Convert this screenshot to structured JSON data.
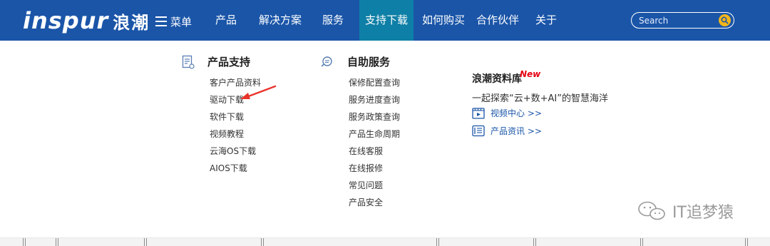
{
  "header": {
    "logo_en": "inspur",
    "logo_cn": "浪潮",
    "menu_label": "菜单",
    "nav": [
      {
        "label": "产品"
      },
      {
        "label": "解决方案"
      },
      {
        "label": "服务"
      },
      {
        "label": "支持下载",
        "active": true
      },
      {
        "label": "如何购买"
      },
      {
        "label": "合作伙伴"
      },
      {
        "label": "关于"
      }
    ],
    "search": {
      "placeholder": "Search"
    }
  },
  "dropdown": {
    "product_support": {
      "title": "产品支持",
      "icon": "document-icon",
      "links": [
        "客户产品资料",
        "驱动下载",
        "软件下载",
        "视频教程",
        "云海OS下载",
        "AIOS下载"
      ]
    },
    "self_service": {
      "title": "自助服务",
      "icon": "magnifier-icon",
      "links": [
        "保修配置查询",
        "服务进度查询",
        "服务政策查询",
        "产品生命周期",
        "在线客服",
        "在线报修",
        "常见问题",
        "产品安全"
      ]
    },
    "library": {
      "title": "浪潮资料库",
      "badge": "New",
      "description": "一起探索“云+数+AI”的智慧海洋",
      "links": [
        {
          "label": "视频中心 >>",
          "icon": "video-icon"
        },
        {
          "label": "产品资讯 >>",
          "icon": "news-icon"
        }
      ]
    }
  },
  "watermark": {
    "text": "IT追梦猿"
  },
  "colors": {
    "nav_bg": "#1a55a8",
    "nav_active": "#0e7fa6",
    "accent_red": "#e60012",
    "link_blue": "#1a55a8"
  }
}
